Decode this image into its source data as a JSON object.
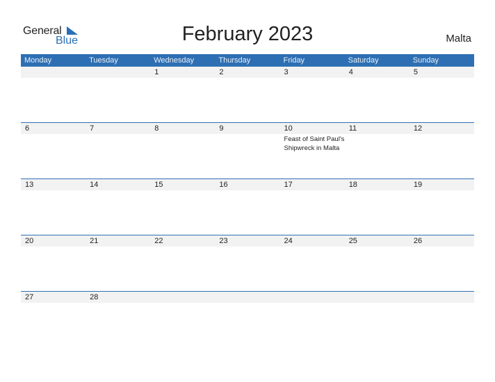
{
  "logo": {
    "line1": "General",
    "line2": "Blue"
  },
  "title": "February 2023",
  "country": "Malta",
  "days": [
    "Monday",
    "Tuesday",
    "Wednesday",
    "Thursday",
    "Friday",
    "Saturday",
    "Sunday"
  ],
  "weeks": [
    [
      {
        "d": ""
      },
      {
        "d": ""
      },
      {
        "d": "1"
      },
      {
        "d": "2"
      },
      {
        "d": "3"
      },
      {
        "d": "4"
      },
      {
        "d": "5"
      }
    ],
    [
      {
        "d": "6"
      },
      {
        "d": "7"
      },
      {
        "d": "8"
      },
      {
        "d": "9"
      },
      {
        "d": "10",
        "ev": "Feast of Saint Paul's Shipwreck in Malta"
      },
      {
        "d": "11"
      },
      {
        "d": "12"
      }
    ],
    [
      {
        "d": "13"
      },
      {
        "d": "14"
      },
      {
        "d": "15"
      },
      {
        "d": "16"
      },
      {
        "d": "17"
      },
      {
        "d": "18"
      },
      {
        "d": "19"
      }
    ],
    [
      {
        "d": "20"
      },
      {
        "d": "21"
      },
      {
        "d": "22"
      },
      {
        "d": "23"
      },
      {
        "d": "24"
      },
      {
        "d": "25"
      },
      {
        "d": "26"
      }
    ],
    [
      {
        "d": "27"
      },
      {
        "d": "28"
      }
    ]
  ]
}
